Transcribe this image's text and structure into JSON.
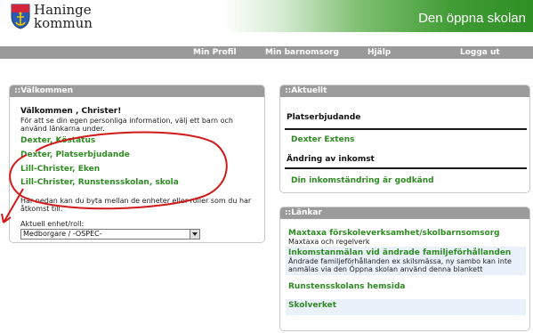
{
  "header": {
    "brand_line1": "Haninge",
    "brand_line2": "kommun",
    "site_title": "Den öppna skolan"
  },
  "nav": {
    "items": [
      "Min Profil",
      "Min barnomsorg",
      "Hjälp",
      "Logga ut"
    ]
  },
  "welcome_panel": {
    "heading": "::Välkommen",
    "greeting": "Välkommen , Christer!",
    "intro": "För att se din egen personliga information, välj ett barn och använd länkarna under.",
    "child_links": [
      "Dexter, Köstatus",
      "Dexter, Platserbjudande",
      "Lill-Christer, Eken",
      "Lill-Christer, Runstensskolan, skola"
    ],
    "switch_text": "Här nedan kan du byta mellan de enheter eller roller som du har åtkomst till.",
    "role_label": "Aktuell enhet/roll:",
    "role_value": "Medborgare / -OSPEC-"
  },
  "news_panel": {
    "heading": "::Aktuellt",
    "section1_title": "Platserbjudande",
    "section1_link": "Dexter Extens",
    "section2_title": "Ändring av inkomst",
    "section2_link": "Din inkomständring är godkänd"
  },
  "links_panel": {
    "heading": "::Länkar",
    "links": [
      {
        "title": "Maxtaxa förskoleverksamhet/skolbarnsomsorg",
        "desc": "Maxtaxa och regelverk"
      },
      {
        "title": "Inkomstanmälan vid ändrade familjeförhållanden",
        "desc": "Ändrade familjeförhållanden ex skilsmässa, ny sambo kan inte anmälas via den Öppna skolan använd denna blankett"
      },
      {
        "title": "Runstensskolans hemsida",
        "desc": ""
      },
      {
        "title": "Skolverket",
        "desc": ""
      }
    ]
  },
  "colors": {
    "link_green": "#2e8b22",
    "panel_header_gray": "#9b9b9b",
    "annotation_red": "#d11a1a"
  },
  "icons": {
    "logo": "coat-of-arms-icon",
    "select_arrow": "chevron-down-icon"
  }
}
